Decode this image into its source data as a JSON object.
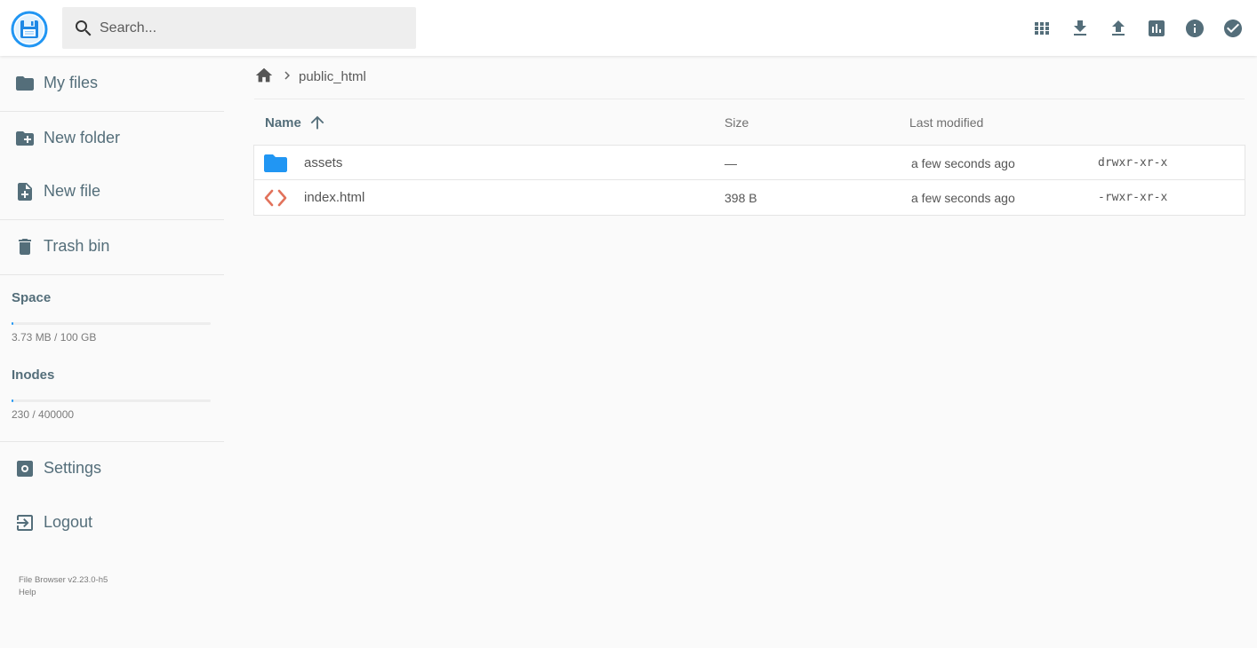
{
  "header": {
    "search_placeholder": "Search...",
    "actions": [
      "view-grid-icon",
      "download-icon",
      "upload-icon",
      "disk-usage-icon",
      "info-icon",
      "select-multiple-icon"
    ]
  },
  "sidebar": {
    "items": [
      {
        "label": "My files",
        "icon": "folder-icon"
      },
      {
        "label": "New folder",
        "icon": "create-new-folder-icon"
      },
      {
        "label": "New file",
        "icon": "note-add-icon"
      },
      {
        "label": "Trash bin",
        "icon": "trash-icon"
      }
    ],
    "space": {
      "title": "Space",
      "text": "3.73 MB / 100 GB",
      "fraction": 3.73e-05
    },
    "inodes": {
      "title": "Inodes",
      "text": "230 / 400000",
      "fraction": 0.000575
    },
    "bottom_items": [
      {
        "label": "Settings",
        "icon": "settings-icon"
      },
      {
        "label": "Logout",
        "icon": "logout-icon"
      }
    ],
    "credits": {
      "version": "File Browser v2.23.0-h5",
      "help": "Help"
    }
  },
  "breadcrumb": {
    "current": "public_html"
  },
  "listing": {
    "columns": {
      "name": "Name",
      "size": "Size",
      "modified": "Last modified"
    },
    "rows": [
      {
        "name": "assets",
        "size": "—",
        "modified": "a few seconds ago",
        "perm": "drwxr-xr-x",
        "icon": "folder-icon"
      },
      {
        "name": "index.html",
        "size": "398 B",
        "modified": "a few seconds ago",
        "perm": "-rwxr-xr-x",
        "icon": "code-file-icon"
      }
    ]
  },
  "colors": {
    "accent": "#2196f3",
    "text": "#546e7a",
    "html_icon": "#e2725b"
  }
}
